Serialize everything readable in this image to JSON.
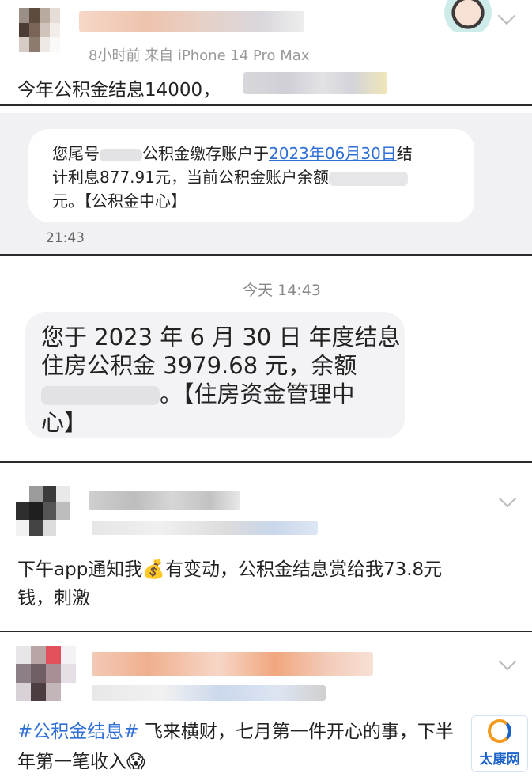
{
  "post1": {
    "meta": "8小时前  来自 iPhone 14 Pro Max",
    "text": "今年公积金结息14000，"
  },
  "sms1": {
    "line1_a": "您尾号",
    "line1_b": "公积金缴存账户于",
    "line1_link": "2023年06月30日",
    "line1_c": "结",
    "line2_a": "计利息877.91元，当前公积金账户余额",
    "line3": "元。【公积金中心】",
    "time": "21:43"
  },
  "sms2": {
    "header_time": "今天 14:43",
    "line1": "您于 2023 年 6 月 30 日 年度结息",
    "line2": "住房公积金 3979.68 元，余额",
    "line3_b": "。【住房资金管理中",
    "line4": "心】"
  },
  "post2": {
    "text_line1_a": "下午app通知我",
    "emoji": "💰",
    "text_line1_b": "有变动，公积金结息赏给我73.8元",
    "text_line2": "钱，刺激"
  },
  "post3": {
    "hashtag": "#公积金结息#",
    "text_line1": " 飞来横财，七月第一件开心的事，下半",
    "text_line2": "年第一笔收入",
    "emoji": "😱"
  },
  "watermark": {
    "text": "太康网"
  },
  "colors": {
    "link": "#2f6fd6",
    "hashtag": "#2f6fd6",
    "sms_bg": "#f1f1f3",
    "watermark": "#1a62c9"
  }
}
